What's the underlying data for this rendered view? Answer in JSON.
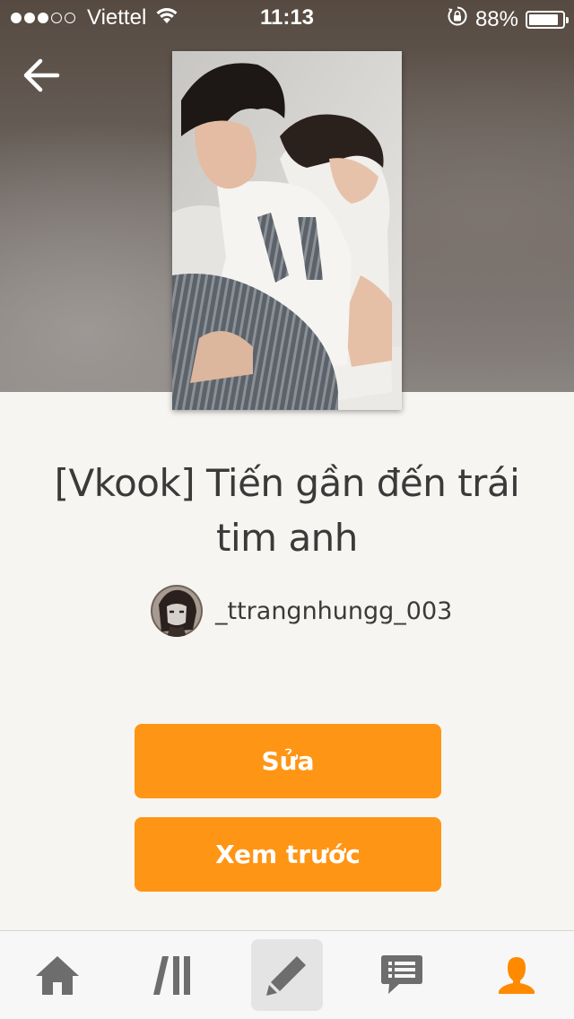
{
  "status_bar": {
    "carrier": "Viettel",
    "time": "11:13",
    "battery_percent": "88%",
    "battery_level": 0.88,
    "signal_bars_filled": 3,
    "signal_bars_total": 5
  },
  "header": {
    "back_icon": "arrow-left-icon",
    "cover_image": "story-cover"
  },
  "story": {
    "title": "[Vkook] Tiến gần đến trái tim anh",
    "author": "_ttrangnhungg_003"
  },
  "actions": {
    "edit_label": "Sửa",
    "preview_label": "Xem trước"
  },
  "tab_bar": {
    "items": [
      {
        "icon": "home-icon"
      },
      {
        "icon": "library-icon"
      },
      {
        "icon": "pencil-icon",
        "active": true
      },
      {
        "icon": "chat-icon"
      },
      {
        "icon": "profile-icon"
      }
    ]
  },
  "colors": {
    "accent": "#ff9514",
    "tab_icon": "#6d6d6d",
    "tab_active_icon": "#ff8a00",
    "title_text": "#3a3a3a",
    "page_bg": "#f7f5f1"
  }
}
